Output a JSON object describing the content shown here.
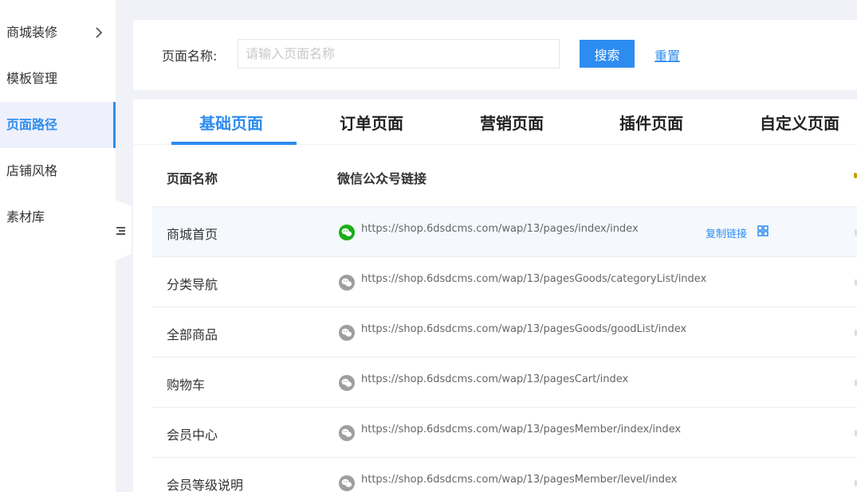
{
  "sidebar": {
    "items": [
      {
        "label": "商城装修",
        "has_arrow": true
      },
      {
        "label": "模板管理"
      },
      {
        "label": "页面路径",
        "active": true
      },
      {
        "label": "店铺风格"
      },
      {
        "label": "素材库"
      }
    ]
  },
  "search": {
    "label": "页面名称:",
    "placeholder": "请输入页面名称",
    "value": "",
    "search_button": "搜索",
    "reset_link": "重置"
  },
  "tabs": [
    {
      "label": "基础页面",
      "active": true
    },
    {
      "label": "订单页面"
    },
    {
      "label": "营销页面"
    },
    {
      "label": "插件页面"
    },
    {
      "label": "自定义页面"
    }
  ],
  "table": {
    "columns": [
      "页面名称",
      "微信公众号链接"
    ],
    "rows": [
      {
        "name": "商城首页",
        "url": "https://shop.6dsdcms.com/wap/13/pages/index/index",
        "copy_label": "复制链接",
        "hovered": true
      },
      {
        "name": "分类导航",
        "url": "https://shop.6dsdcms.com/wap/13/pagesGoods/categoryList/index"
      },
      {
        "name": "全部商品",
        "url": "https://shop.6dsdcms.com/wap/13/pagesGoods/goodList/index"
      },
      {
        "name": "购物车",
        "url": "https://shop.6dsdcms.com/wap/13/pagesCart/index"
      },
      {
        "name": "会员中心",
        "url": "https://shop.6dsdcms.com/wap/13/pagesMember/index/index"
      },
      {
        "name": "会员等级说明",
        "url": "https://shop.6dsdcms.com/wap/13/pagesMember/level/index"
      }
    ]
  },
  "icons": {
    "wechat_active": "wechat-icon",
    "wechat_inactive": "wechat-icon",
    "qr": "qrcode-icon",
    "menu_toggle": "menu-collapse-icon"
  },
  "colors": {
    "accent": "#2d8cf0",
    "wechat_green": "#1aad19",
    "wechat_gray": "#9e9e9e",
    "page_bg": "#f0f2f8"
  }
}
